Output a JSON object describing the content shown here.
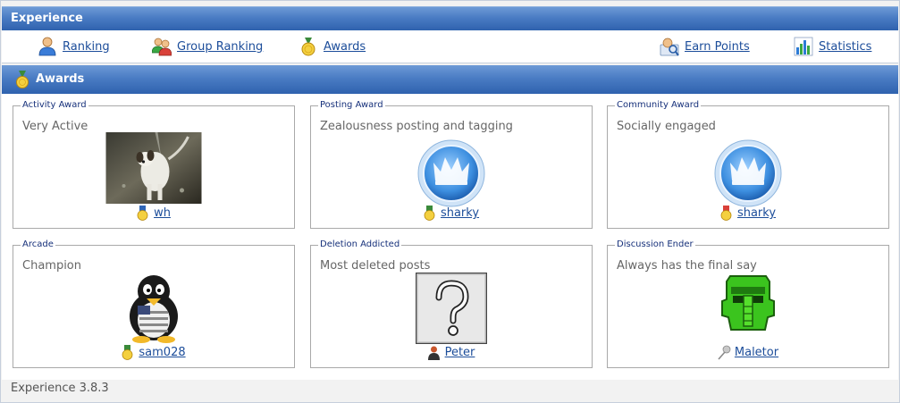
{
  "header": {
    "title": "Experience"
  },
  "nav": {
    "ranking": "Ranking",
    "group_ranking": "Group Ranking",
    "awards": "Awards",
    "earn_points": "Earn Points",
    "statistics": "Statistics"
  },
  "section": {
    "title": "Awards"
  },
  "awards": [
    {
      "category": "Activity Award",
      "description": "Very Active",
      "winner": "wh",
      "medal": "gold"
    },
    {
      "category": "Posting Award",
      "description": "Zealousness posting and tagging",
      "winner": "sharky",
      "medal": "gold"
    },
    {
      "category": "Community Award",
      "description": "Socially engaged",
      "winner": "sharky",
      "medal": "red"
    },
    {
      "category": "Arcade",
      "description": "Champion",
      "winner": "sam028",
      "medal": "gold"
    },
    {
      "category": "Deletion Addicted",
      "description": "Most deleted posts",
      "winner": "Peter",
      "medal": "user"
    },
    {
      "category": "Discussion Ender",
      "description": "Always has the final say",
      "winner": "Maletor",
      "medal": "pin"
    }
  ],
  "footer": {
    "version": "Experience 3.8.3"
  },
  "colors": {
    "header_blue": "#4a7cc4",
    "link": "#1c4d9a",
    "legend": "#16307a"
  }
}
